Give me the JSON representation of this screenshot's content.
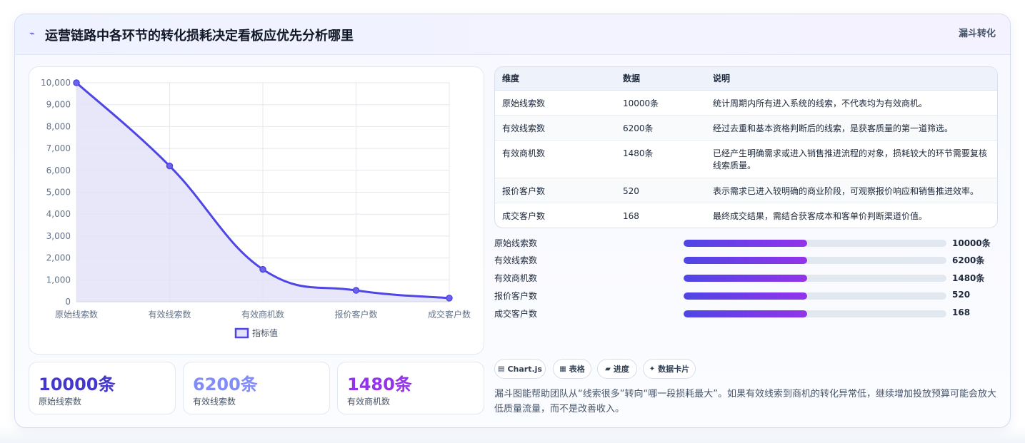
{
  "header": {
    "icon": "spark-line-icon",
    "title": "运营链路中各环节的转化损耗决定看板应优先分析哪里",
    "tag": "漏斗转化"
  },
  "chart_data": {
    "type": "line",
    "fill": "area",
    "smooth": true,
    "categories": [
      "原始线索数",
      "有效线索数",
      "有效商机数",
      "报价客户数",
      "成交客户数"
    ],
    "series": [
      {
        "name": "指标值",
        "values": [
          10000,
          6200,
          1480,
          520,
          168
        ]
      }
    ],
    "ylim": [
      0,
      10000
    ],
    "yticks": [
      "0",
      "1,000",
      "2,000",
      "3,000",
      "4,000",
      "5,000",
      "6,000",
      "7,000",
      "8,000",
      "9,000",
      "10,000"
    ],
    "grid": true,
    "legend": "bottom",
    "colors": {
      "line": "#4f46e5",
      "area": "#e4e2f8",
      "grid": "#e5e7eb"
    }
  },
  "kpis": [
    {
      "value": "10000条",
      "label": "原始线索数",
      "color": "#4338ca"
    },
    {
      "value": "6200条",
      "label": "有效线索数",
      "color": "#818cf8"
    },
    {
      "value": "1480条",
      "label": "有效商机数",
      "color": "#9333ea"
    }
  ],
  "table": {
    "headers": [
      "维度",
      "数据",
      "说明"
    ],
    "rows": [
      {
        "dim": "原始线索数",
        "data": "10000条",
        "desc": "统计周期内所有进入系统的线索，不代表均为有效商机。"
      },
      {
        "dim": "有效线索数",
        "data": "6200条",
        "desc": "经过去重和基本资格判断后的线索，是获客质量的第一道筛选。"
      },
      {
        "dim": "有效商机数",
        "data": "1480条",
        "desc": "已经产生明确需求或进入销售推进流程的对象，损耗较大的环节需要复核线索质量。"
      },
      {
        "dim": "报价客户数",
        "data": "520",
        "desc": "表示需求已进入较明确的商业阶段，可观察报价响应和销售推进效率。"
      },
      {
        "dim": "成交客户数",
        "data": "168",
        "desc": "最终成交结果，需结合获客成本和客单价判断渠道价值。"
      }
    ]
  },
  "progress": [
    {
      "label": "原始线索数",
      "value": "10000条",
      "fraction": 0.47
    },
    {
      "label": "有效线索数",
      "value": "6200条",
      "fraction": 0.47
    },
    {
      "label": "有效商机数",
      "value": "1480条",
      "fraction": 0.47
    },
    {
      "label": "报价客户数",
      "value": "520",
      "fraction": 0.47
    },
    {
      "label": "成交客户数",
      "value": "168",
      "fraction": 0.47
    }
  ],
  "chips": [
    {
      "icon": "chart-icon",
      "glyph": "▤",
      "label": "Chart.js"
    },
    {
      "icon": "table-icon",
      "glyph": "▦",
      "label": "表格"
    },
    {
      "icon": "progress-icon",
      "glyph": "▰",
      "label": "进度"
    },
    {
      "icon": "card-icon",
      "glyph": "✦",
      "label": "数据卡片"
    }
  ],
  "summary": "漏斗图能帮助团队从“线索很多”转向“哪一段损耗最大”。如果有效线索到商机的转化异常低，继续增加投放预算可能会放大低质量流量，而不是改善收入。"
}
